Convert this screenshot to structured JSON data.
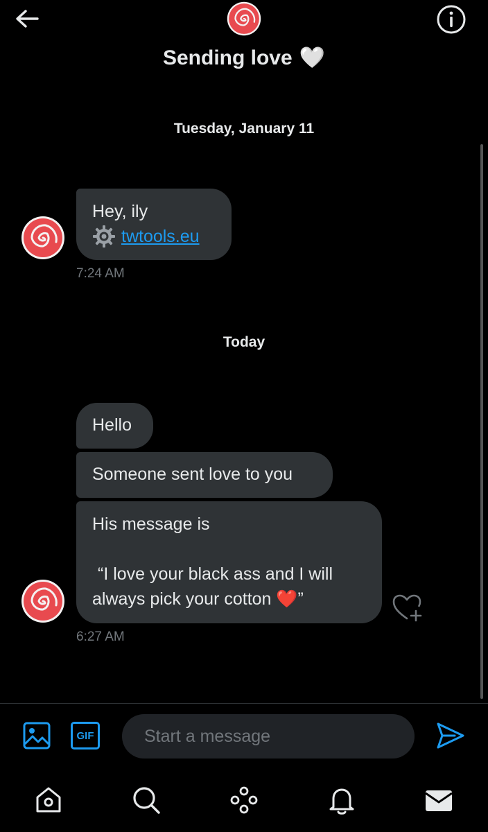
{
  "header": {
    "title": "Sending love",
    "title_emoji": "🤍",
    "back_icon": "arrow-left-icon",
    "info_icon": "info-icon"
  },
  "conversation": {
    "date_separators": [
      "Tuesday, January 11",
      "Today"
    ],
    "message_groups": [
      {
        "messages": [
          {
            "text": "Hey, ily",
            "link_prefix_icon": "gear-icon",
            "link_text": "twtools.eu"
          }
        ],
        "timestamp": "7:24 AM"
      },
      {
        "messages": [
          {
            "text": "Hello"
          },
          {
            "text": "Someone sent love to you"
          },
          {
            "line1": "His message is",
            "line2": "“I love your black ass and I will",
            "line3": "always pick your cotton",
            "emoji": "❤️",
            "close_quote": "”"
          }
        ],
        "timestamp": "6:27 AM"
      }
    ]
  },
  "composer": {
    "placeholder": "Start a message",
    "gif_label": "GIF",
    "icons": [
      "image-icon",
      "gif-icon",
      "send-icon"
    ]
  },
  "bottom_nav": {
    "items": [
      "home-icon",
      "search-icon",
      "spaces-icon",
      "notifications-icon",
      "messages-icon"
    ]
  },
  "colors": {
    "accent": "#1d9bf0",
    "bubble": "#2f3336",
    "background": "#000000",
    "muted_text": "#71767b",
    "avatar_red": "#e84a4f"
  }
}
